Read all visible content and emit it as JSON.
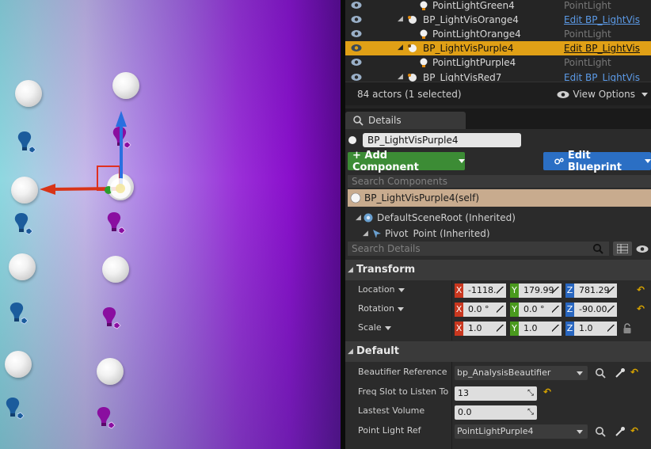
{
  "outliner": {
    "rows": [
      {
        "name": "PointLightGreen4",
        "type": "PointLight",
        "link": false,
        "selected": false
      },
      {
        "name": "BP_LightVisOrange4",
        "type": "Edit BP_LightVis",
        "link": true,
        "selected": false
      },
      {
        "name": "PointLightOrange4",
        "type": "PointLight",
        "link": false,
        "selected": false
      },
      {
        "name": "BP_LightVisPurple4",
        "type": "Edit BP_LightVis",
        "link": true,
        "selected": true
      },
      {
        "name": "PointLightPurple4",
        "type": "PointLight",
        "link": false,
        "selected": false
      },
      {
        "name": "BP_LightVisRed7",
        "type": "Edit BP_LightVis",
        "link": true,
        "selected": false
      }
    ],
    "actor_count": "84 actors (1 selected)",
    "view_options": "View Options"
  },
  "details": {
    "tab_label": "Details",
    "actor_name": "BP_LightVisPurple4",
    "add_component": "+ Add Component",
    "edit_blueprint": "Edit Blueprint",
    "search_components_placeholder": "Search Components",
    "self_row": "BP_LightVisPurple4(self)",
    "tree": [
      "DefaultSceneRoot (Inherited)",
      "Pivot_Point (Inherited)"
    ],
    "search_details_placeholder": "Search Details",
    "transform": {
      "title": "Transform",
      "location": {
        "label": "Location",
        "x": "-1118.",
        "y": "179.99",
        "z": "781.29"
      },
      "rotation": {
        "label": "Rotation",
        "x": "0.0 °",
        "y": "0.0 °",
        "z": "-90.00"
      },
      "scale": {
        "label": "Scale",
        "x": "1.0",
        "y": "1.0",
        "z": "1.0"
      }
    },
    "default": {
      "title": "Default",
      "beautifier": {
        "label": "Beautifier Reference",
        "value": "bp_AnalysisBeautifier"
      },
      "freq_slot": {
        "label": "Freq Slot to Listen To",
        "value": "13"
      },
      "lastest_volume": {
        "label": "Lastest Volume",
        "value": "0.0"
      },
      "point_light": {
        "label": "Point Light Ref",
        "value": "PointLightPurple4"
      }
    }
  },
  "axis_tags": {
    "x": "X",
    "y": "Y",
    "z": "Z"
  },
  "colors": {
    "selection": "#e0a016",
    "add_component": "#3c8c35",
    "edit_blueprint": "#2b6fc4",
    "link": "#5c9be8"
  }
}
